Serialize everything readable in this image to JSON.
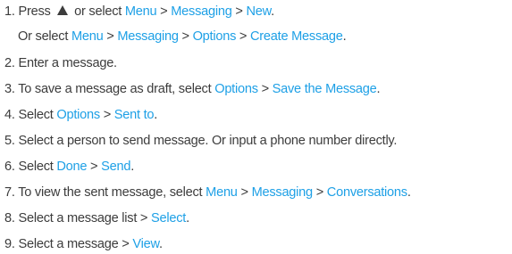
{
  "colors": {
    "text": "#3c3c3c",
    "highlight": "#1ea0e6"
  },
  "steps": [
    {
      "number": "1.",
      "segments": [
        {
          "text": "Press ",
          "hl": false
        },
        {
          "icon": "up-arrow-icon"
        },
        {
          "text": " or select ",
          "hl": false
        },
        {
          "text": "Menu",
          "hl": true
        },
        {
          "text": " > ",
          "hl": false
        },
        {
          "text": "Messaging",
          "hl": true
        },
        {
          "text": " > ",
          "hl": false
        },
        {
          "text": "New",
          "hl": true
        },
        {
          "text": ".",
          "hl": false
        }
      ]
    },
    {
      "number": "",
      "segments": [
        {
          "text": "Or select ",
          "hl": false
        },
        {
          "text": "Menu",
          "hl": true
        },
        {
          "text": " > ",
          "hl": false
        },
        {
          "text": "Messaging",
          "hl": true
        },
        {
          "text": " > ",
          "hl": false
        },
        {
          "text": "Options",
          "hl": true
        },
        {
          "text": " > ",
          "hl": false
        },
        {
          "text": "Create Message",
          "hl": true
        },
        {
          "text": ".",
          "hl": false
        }
      ]
    },
    {
      "number": "2.",
      "segments": [
        {
          "text": "Enter a message.",
          "hl": false
        }
      ]
    },
    {
      "number": "3.",
      "segments": [
        {
          "text": "To save a message as draft, select ",
          "hl": false
        },
        {
          "text": "Options",
          "hl": true
        },
        {
          "text": " > ",
          "hl": false
        },
        {
          "text": "Save the Message",
          "hl": true
        },
        {
          "text": ".",
          "hl": false
        }
      ]
    },
    {
      "number": "4.",
      "segments": [
        {
          "text": "Select ",
          "hl": false
        },
        {
          "text": "Options",
          "hl": true
        },
        {
          "text": " > ",
          "hl": false
        },
        {
          "text": "Sent to",
          "hl": true
        },
        {
          "text": ".",
          "hl": false
        }
      ]
    },
    {
      "number": "5.",
      "segments": [
        {
          "text": "Select a person to send message. Or input a phone number directly.",
          "hl": false
        }
      ]
    },
    {
      "number": "6.",
      "segments": [
        {
          "text": "Select ",
          "hl": false
        },
        {
          "text": "Done",
          "hl": true
        },
        {
          "text": " > ",
          "hl": false
        },
        {
          "text": "Send",
          "hl": true
        },
        {
          "text": ".",
          "hl": false
        }
      ]
    },
    {
      "number": "7.",
      "segments": [
        {
          "text": "To view the sent message, select ",
          "hl": false
        },
        {
          "text": "Menu",
          "hl": true
        },
        {
          "text": " > ",
          "hl": false
        },
        {
          "text": "Messaging",
          "hl": true
        },
        {
          "text": " > ",
          "hl": false
        },
        {
          "text": "Conversations",
          "hl": true
        },
        {
          "text": ".",
          "hl": false
        }
      ]
    },
    {
      "number": "8.",
      "segments": [
        {
          "text": "Select a message list > ",
          "hl": false
        },
        {
          "text": "Select",
          "hl": true
        },
        {
          "text": ".",
          "hl": false
        }
      ]
    },
    {
      "number": "9.",
      "segments": [
        {
          "text": "Select a message > ",
          "hl": false
        },
        {
          "text": "View",
          "hl": true
        },
        {
          "text": ".",
          "hl": false
        }
      ]
    }
  ]
}
